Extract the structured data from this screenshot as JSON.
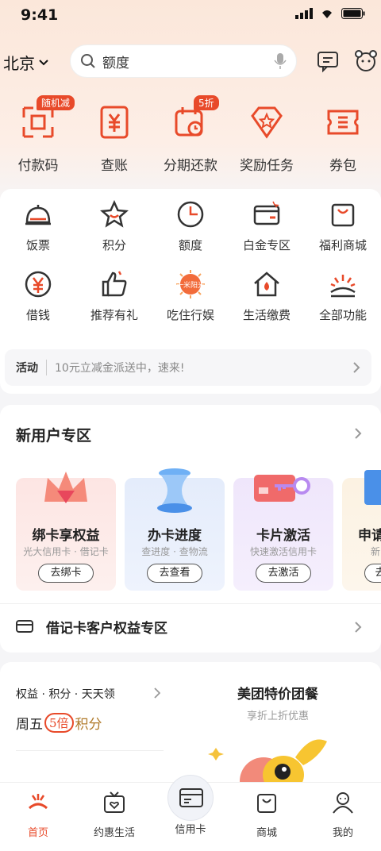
{
  "status": {
    "time": "9:41"
  },
  "header": {
    "city": "北京",
    "search_placeholder": "额度"
  },
  "quick": [
    {
      "label": "付款码",
      "badge": "随机减"
    },
    {
      "label": "查账",
      "badge": ""
    },
    {
      "label": "分期还款",
      "badge": "5折"
    },
    {
      "label": "奖励任务",
      "badge": ""
    },
    {
      "label": "券包",
      "badge": ""
    }
  ],
  "grid": [
    {
      "label": "饭票",
      "icon": "bell-cover-icon"
    },
    {
      "label": "积分",
      "icon": "star-icon"
    },
    {
      "label": "额度",
      "icon": "pie-clock-icon"
    },
    {
      "label": "白金专区",
      "icon": "card-wallet-icon"
    },
    {
      "label": "福利商城",
      "icon": "shopping-bag-icon"
    },
    {
      "label": "借钱",
      "icon": "yen-coin-icon"
    },
    {
      "label": "推荐有礼",
      "icon": "thumbs-up-icon"
    },
    {
      "label": "吃住行娱",
      "icon": "sun-badge-icon",
      "badge_text": "一米阳光"
    },
    {
      "label": "生活缴费",
      "icon": "house-drop-icon"
    },
    {
      "label": "全部功能",
      "icon": "sunrise-icon"
    }
  ],
  "promo": {
    "tag": "活动",
    "text": "10元立减金派送中，速来!"
  },
  "new_user": {
    "title": "新用户专区",
    "cards": [
      {
        "title": "绑卡享权益",
        "subtitle": "光大信用卡 · 借记卡",
        "button": "去绑卡"
      },
      {
        "title": "办卡进度",
        "subtitle": "查进度 · 查物流",
        "button": "去查看"
      },
      {
        "title": "卡片激活",
        "subtitle": "快速激活信用卡",
        "button": "去激活"
      },
      {
        "title": "申请",
        "subtitle": "新",
        "button": "去"
      }
    ],
    "debit_zone": "借记卡客户权益专区"
  },
  "bottom_cards": {
    "left_title": "权益 · 积分 · 天天领",
    "left_slogan": "周五",
    "left_slogan_badge": "5倍",
    "left_slogan_tail": "积分",
    "right_title": "美团特价团餐",
    "right_subtitle": "享折上折优惠"
  },
  "tabs": [
    {
      "label": "首页"
    },
    {
      "label": "约惠生活"
    },
    {
      "label": "信用卡"
    },
    {
      "label": "商城"
    },
    {
      "label": "我的"
    }
  ],
  "colors": {
    "accent": "#e84a2a",
    "text": "#222222"
  }
}
